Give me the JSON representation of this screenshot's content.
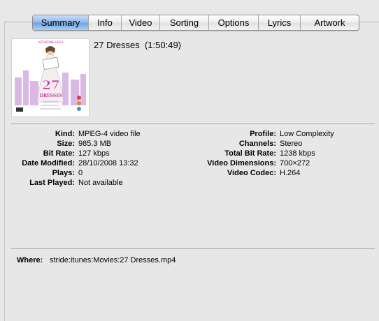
{
  "tabs": [
    {
      "label": "Summary",
      "active": true
    },
    {
      "label": "Info",
      "active": false
    },
    {
      "label": "Video",
      "active": false
    },
    {
      "label": "Sorting",
      "active": false
    },
    {
      "label": "Options",
      "active": false
    },
    {
      "label": "Lyrics",
      "active": false
    },
    {
      "label": "Artwork",
      "active": false
    }
  ],
  "summary": {
    "title_line": "27 Dresses  (1:50:49)",
    "artwork": {
      "top_text": "KATHERINE HEIGL",
      "big_number": "27",
      "word": "DRESSES",
      "accent_color": "#c83aa0"
    }
  },
  "left_fields": [
    {
      "label": "Kind:",
      "value": "MPEG-4 video file"
    },
    {
      "label": "Size:",
      "value": "985.3 MB"
    },
    {
      "label": "Bit Rate:",
      "value": "127 kbps"
    },
    {
      "label": "Date Modified:",
      "value": "28/10/2008 13:32"
    },
    {
      "label": "Plays:",
      "value": "0"
    },
    {
      "label": "Last Played:",
      "value": "Not available"
    }
  ],
  "right_fields": [
    {
      "label": "Profile:",
      "value": "Low Complexity"
    },
    {
      "label": "Channels:",
      "value": "Stereo"
    },
    {
      "label": "Total Bit Rate:",
      "value": "1238 kbps"
    },
    {
      "label": "Video Dimensions:",
      "value": "700×272"
    },
    {
      "label": "Video Codec:",
      "value": "H.264"
    }
  ],
  "where": {
    "label": "Where:",
    "value": "stride:itunes:Movies:27 Dresses.mp4"
  }
}
